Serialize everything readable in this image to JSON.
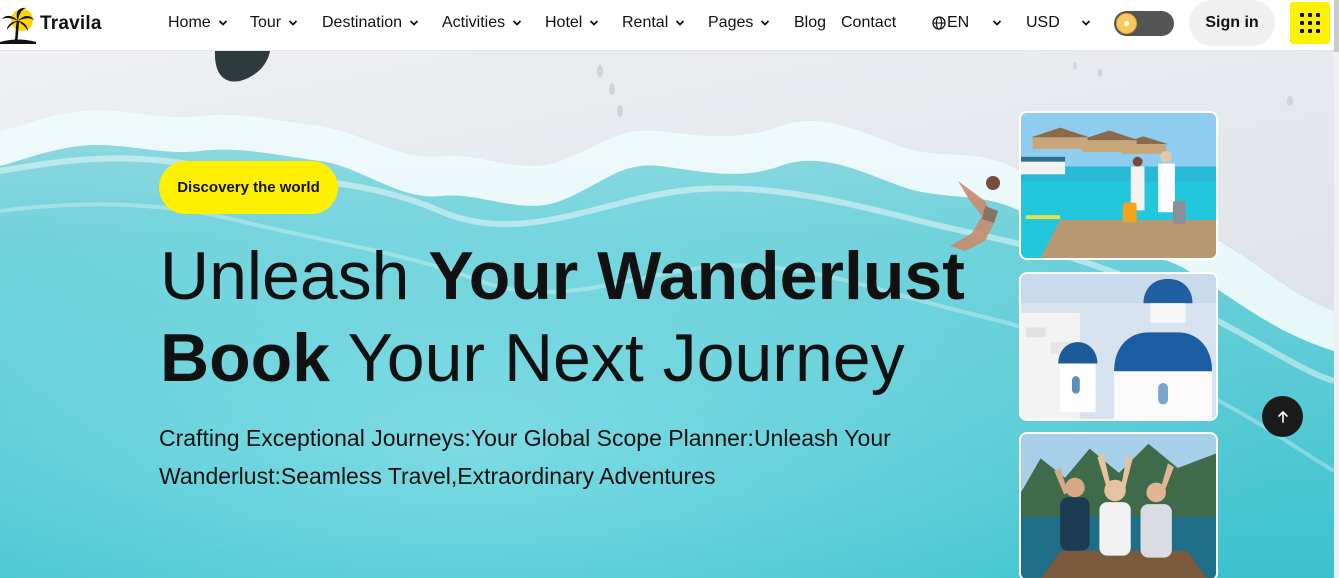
{
  "brand": {
    "name": "Travila"
  },
  "nav": {
    "items": [
      {
        "label": "Home",
        "has_dropdown": true
      },
      {
        "label": "Tour",
        "has_dropdown": true
      },
      {
        "label": "Destination",
        "has_dropdown": true
      },
      {
        "label": "Activities",
        "has_dropdown": true
      },
      {
        "label": "Hotel",
        "has_dropdown": true
      },
      {
        "label": "Rental",
        "has_dropdown": true
      },
      {
        "label": "Pages",
        "has_dropdown": true
      },
      {
        "label": "Blog",
        "has_dropdown": false
      },
      {
        "label": "Contact",
        "has_dropdown": false
      }
    ]
  },
  "header_controls": {
    "language": "EN",
    "currency": "USD",
    "theme_toggle": "light",
    "signin_label": "Sign in",
    "menu_icon": "grid-menu-icon"
  },
  "hero": {
    "badge": "Discovery the world",
    "headline_line1_regular": "Unleash ",
    "headline_line1_bold": "Your Wanderlust",
    "headline_line2_bold": "Book",
    "headline_line2_regular": " Your Next Journey",
    "subtitle": "Crafting Exceptional Journeys:Your Global Scope Planner:Unleash Your Wanderlust:Seamless Travel,Extraordinary Adventures"
  },
  "gallery": [
    {
      "scene": "overwater-bungalows-couple"
    },
    {
      "scene": "santorini-blue-domes"
    },
    {
      "scene": "friends-on-boat"
    }
  ],
  "colors": {
    "accent_yellow": "#ffef00",
    "text": "#111111",
    "sea": "#4fc9d3",
    "dark_button": "#1a1a1a"
  },
  "scroll_top_icon": "arrow-up-icon"
}
